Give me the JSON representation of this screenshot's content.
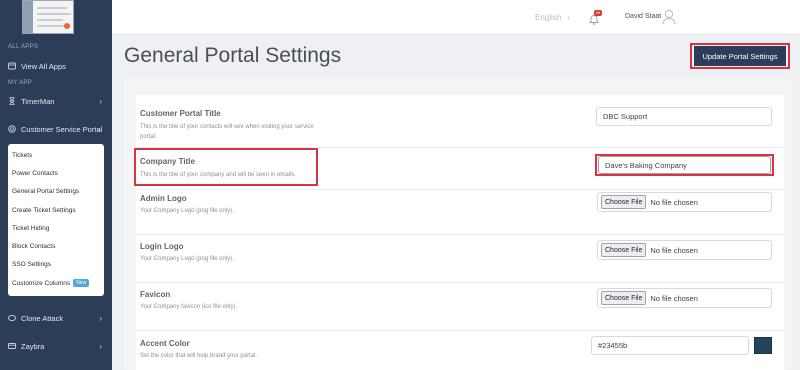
{
  "sidebar": {
    "section_all_apps": "ALL APPS",
    "view_all_apps": "View All Apps",
    "section_my_app": "MY APP",
    "timerman": "TimerMan",
    "customer_service_portal": "Customer Service Portal",
    "submenu": [
      "Tickets",
      "Power Contacts",
      "General Portal Settings",
      "Create Ticket Settings",
      "Ticket Hiding",
      "Block Contacts",
      "SSO Settings",
      "Customize Columns"
    ],
    "new_badge": "New",
    "clone_attack": "Clone Attack",
    "zaybra": "Zaybra"
  },
  "topbar": {
    "language": "English",
    "notification_count": "49",
    "user_name": "David Staat"
  },
  "page": {
    "title": "General Portal Settings",
    "update_button": "Update Portal Settings"
  },
  "fields": {
    "customer_portal_title": {
      "label": "Customer Portal Title",
      "description": "This is the title of your contacts will see when visiting your service portal.",
      "value": "DBC Support"
    },
    "company_title": {
      "label": "Company Title",
      "description": "This is the title of your company and will be seen in emails.",
      "value": "Dave's Baking Company"
    },
    "admin_logo": {
      "label": "Admin Logo",
      "description": "Your Company Logo (png file only).",
      "button": "Choose File",
      "status": "No file chosen"
    },
    "login_logo": {
      "label": "Login Logo",
      "description": "Your Company Logo (png file only).",
      "button": "Choose File",
      "status": "No file chosen"
    },
    "favicon": {
      "label": "Favicon",
      "description": "Your Company favicon (ico file only).",
      "button": "Choose File",
      "status": "No file chosen"
    },
    "accent_color": {
      "label": "Accent Color",
      "description": "Set the color that will help brand your portal.",
      "value": "#23455b"
    }
  },
  "colors": {
    "sidebar": "#2c3e57",
    "highlight": "#d9333f",
    "accent": "#23455b"
  }
}
